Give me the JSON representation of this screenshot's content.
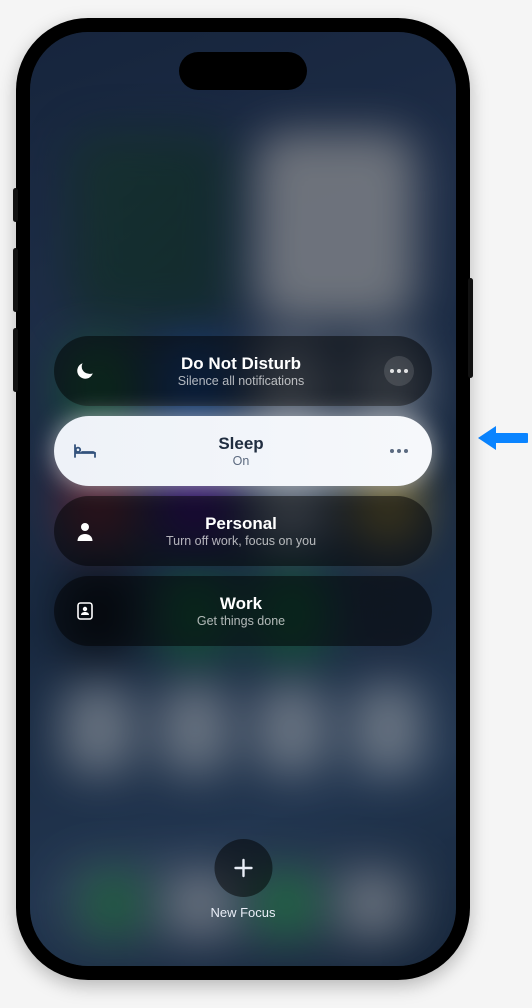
{
  "focus_modes": [
    {
      "key": "dnd",
      "title": "Do Not Disturb",
      "subtitle": "Silence all notifications",
      "has_more": true
    },
    {
      "key": "sleep",
      "title": "Sleep",
      "subtitle": "On",
      "has_more": true
    },
    {
      "key": "personal",
      "title": "Personal",
      "subtitle": "Turn off work, focus on you",
      "has_more": false
    },
    {
      "key": "work",
      "title": "Work",
      "subtitle": "Get things done",
      "has_more": false
    }
  ],
  "active_mode_key": "sleep",
  "new_focus_label": "New Focus",
  "callout_target_key": "sleep",
  "colors": {
    "arrow": "#0a84ff"
  }
}
